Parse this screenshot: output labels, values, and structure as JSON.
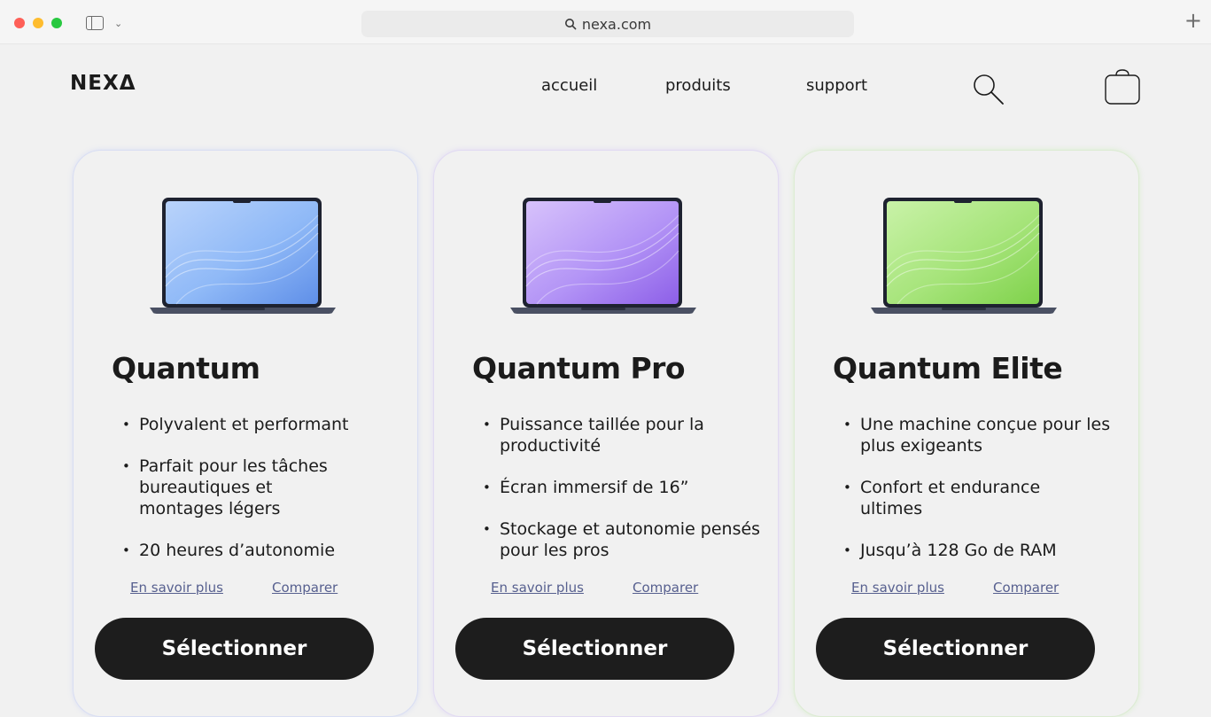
{
  "browser": {
    "url": "nexa.com",
    "icons": [
      "close-dot",
      "minimize-dot",
      "zoom-dot",
      "sidebar-icon",
      "chevron-down-icon",
      "search-icon",
      "plus-icon"
    ]
  },
  "header": {
    "logo": "NEXΔ",
    "nav": [
      "accueil",
      "produits",
      "support"
    ],
    "icons": [
      "search-icon",
      "cart-icon"
    ]
  },
  "products": [
    {
      "name": "Quantum",
      "accent": "#7aa9f2",
      "features": [
        "Polyvalent et performant",
        "Parfait pour les tâches bureautiques et montages légers",
        "20 heures d’autonomie"
      ],
      "learn_more": "En savoir plus",
      "compare": "Comparer",
      "select": "Sélectionner"
    },
    {
      "name": "Quantum Pro",
      "accent": "#a983f0",
      "features": [
        "Puissance taillée pour la productivité",
        "Écran immersif de 16”",
        "Stockage et autonomie pensés pour les pros"
      ],
      "learn_more": "En savoir plus",
      "compare": "Comparer",
      "select": "Sélectionner"
    },
    {
      "name": "Quantum Elite",
      "accent": "#98de62",
      "features": [
        "Une machine conçue pour les plus exigeants",
        "Confort et endurance ultimes",
        "Jusqu’à 128 Go de RAM"
      ],
      "learn_more": "En savoir plus",
      "compare": "Comparer",
      "select": "Sélectionner"
    }
  ]
}
